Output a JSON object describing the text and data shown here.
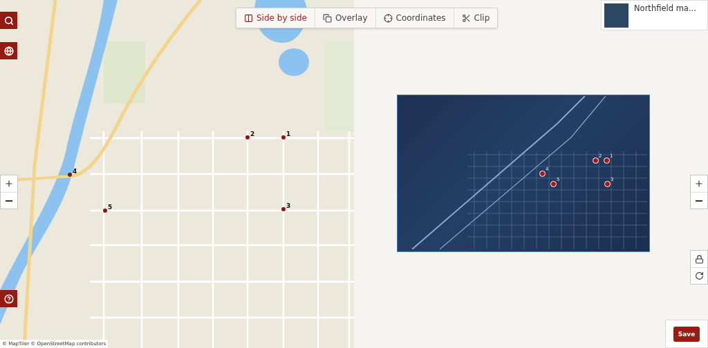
{
  "toolbar": {
    "tabs": [
      {
        "label": "Side by side",
        "kind": "side",
        "selected": true
      },
      {
        "label": "Overlay",
        "kind": "overlay",
        "selected": false
      },
      {
        "label": "Coordinates",
        "kind": "coords",
        "selected": false
      },
      {
        "label": "Clip",
        "kind": "clip",
        "selected": false
      }
    ]
  },
  "map": {
    "attribution": "© MapTiler © OpenStreetMap contributors",
    "control_points": [
      {
        "label": "1"
      },
      {
        "label": "2"
      },
      {
        "label": "3"
      },
      {
        "label": "4"
      },
      {
        "label": "5"
      }
    ]
  },
  "image": {
    "control_points": [
      {
        "label": "1"
      },
      {
        "label": "2"
      },
      {
        "label": "3"
      },
      {
        "label": "4"
      },
      {
        "label": "5"
      }
    ]
  },
  "thumbnail": {
    "title": "Northfield ma..."
  },
  "save": {
    "label": "Save"
  }
}
